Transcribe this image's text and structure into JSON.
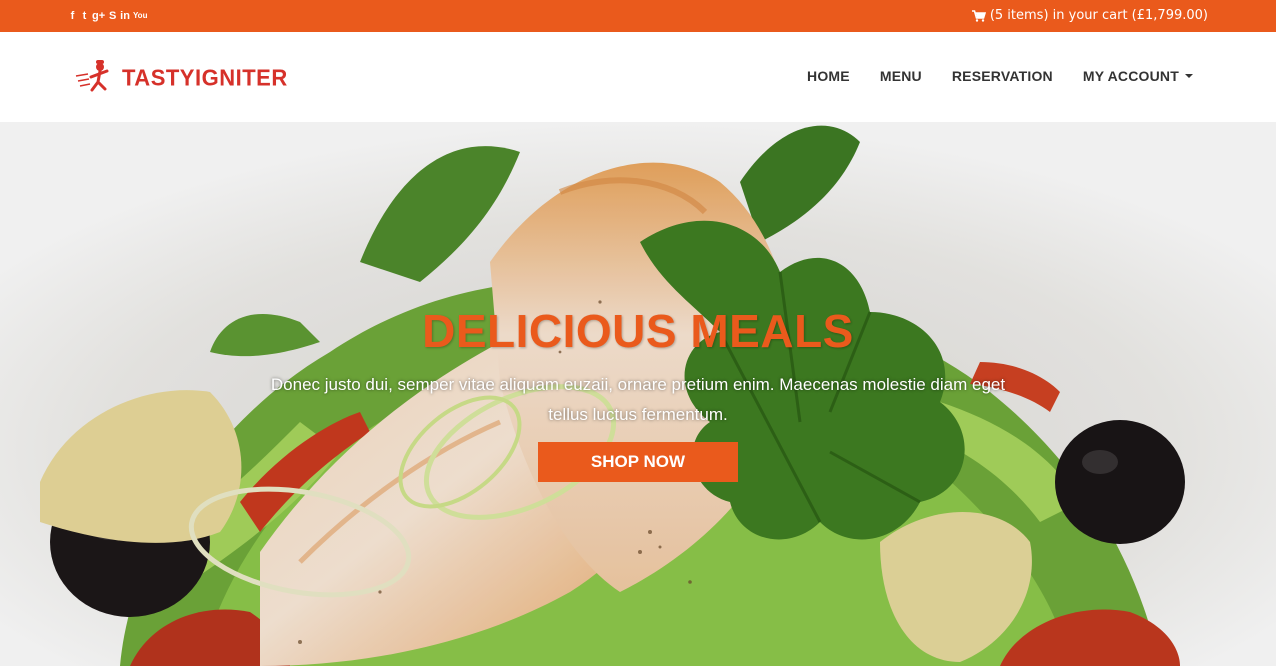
{
  "topbar": {
    "social_icons": [
      {
        "name": "facebook-icon",
        "glyph": "f"
      },
      {
        "name": "twitter-icon",
        "glyph": "t"
      },
      {
        "name": "google-plus-icon",
        "glyph": "g+"
      },
      {
        "name": "skype-icon",
        "glyph": "S"
      },
      {
        "name": "linkedin-icon",
        "glyph": "in"
      },
      {
        "name": "youtube-icon",
        "glyph": "You"
      }
    ],
    "cart_text": "(5 items) in your cart (£1,799.00)"
  },
  "header": {
    "logo_text": "TASTYIGNITER",
    "nav": {
      "home": "HOME",
      "menu": "MENU",
      "reservation": "RESERVATION",
      "my_account": "MY ACCOUNT"
    }
  },
  "hero": {
    "title": "DELICIOUS MEALS",
    "text": "Donec justo dui, semper vitae aliquam euzaii, ornare pretium enim. Maecenas molestie diam eget tellus luctus fermentum.",
    "button": "SHOP NOW"
  },
  "colors": {
    "accent": "#ea5a1c",
    "logo": "#d6312a",
    "nav_text": "#333333"
  }
}
